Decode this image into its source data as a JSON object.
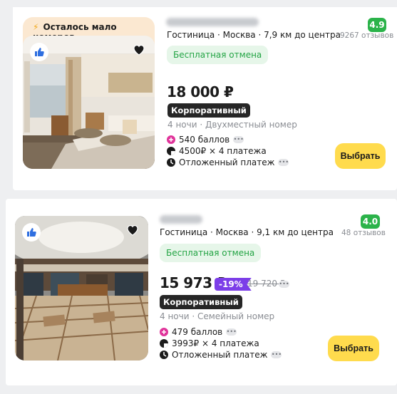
{
  "hotels": [
    {
      "badge": "Осталось мало номеров",
      "type": "Гостиница",
      "city": "Москва",
      "distance": "7,9 км до центра",
      "rating": "4.9",
      "reviews": "9267 отзывов",
      "cancellation": "Бесплатная отмена",
      "price": "18 000 ₽",
      "tariff": "Корпоративный",
      "room": "4 ночи · Двухместный номер",
      "points": "540 баллов",
      "installments": "4500₽ × 4 платежа",
      "deferred": "Отложенный платеж",
      "cta": "Выбрать"
    },
    {
      "type": "Гостиница",
      "city": "Москва",
      "distance": "9,1 км до центра",
      "rating": "4.0",
      "reviews": "48 отзывов",
      "cancellation": "Бесплатная отмена",
      "price": "15 973 ₽",
      "discount": "-19%",
      "old_price": "19 720 ₽",
      "tariff": "Корпоративный",
      "room": "4 ночи · Семейный номер",
      "points": "479 баллов",
      "installments": "3993₽ × 4 платежа",
      "deferred": "Отложенный платеж",
      "cta": "Выбрать"
    }
  ],
  "colors": {
    "rating_bg": "#2bb34a",
    "cta_bg": "#ffdb4d",
    "discount_bg": "#7c3ee8",
    "free_cancel_text": "#23a444",
    "badge_bg": "#fbe8d1"
  },
  "icons": [
    "bolt-icon",
    "thumbs-up-icon",
    "heart-icon",
    "plus-points-icon",
    "split-payment-icon",
    "deferred-payment-icon",
    "more-dots-icon"
  ]
}
